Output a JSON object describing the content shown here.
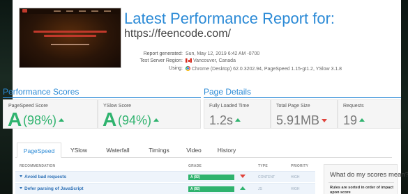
{
  "header": {
    "title": "Latest Performance Report for:",
    "url": "https://feencode.com/",
    "report_generated_label": "Report generated:",
    "report_generated_value": "Sun, May 12, 2019 6:42 AM -0700",
    "server_region_label": "Test Server Region:",
    "server_region_value": "Vancouver, Canada",
    "using_label": "Using:",
    "using_value": "Chrome (Desktop) 62.0.3202.94, PageSpeed 1.15-gt1.2, YSlow 3.1.8"
  },
  "performance_scores": {
    "title": "Performance Scores",
    "pagespeed": {
      "label": "PageSpeed Score",
      "grade": "A",
      "percent": "(98%)"
    },
    "yslow": {
      "label": "YSlow Score",
      "grade": "A",
      "percent": "(94%)"
    }
  },
  "page_details": {
    "title": "Page Details",
    "load_time": {
      "label": "Fully Loaded Time",
      "value": "1.2s",
      "trend": "up"
    },
    "page_size": {
      "label": "Total Page Size",
      "value": "5.91MB",
      "trend": "down"
    },
    "requests": {
      "label": "Requests",
      "value": "19",
      "trend": "up"
    }
  },
  "tabs": [
    "PageSpeed",
    "YSlow",
    "Waterfall",
    "Timings",
    "Video",
    "History"
  ],
  "active_tab": "PageSpeed",
  "table": {
    "headers": {
      "recommendation": "RECOMMENDATION",
      "grade": "GRADE",
      "type": "TYPE",
      "priority": "PRIORITY"
    },
    "rows": [
      {
        "name": "Avoid bad requests",
        "grade": "A (92)",
        "grade_pct": 92,
        "trend": "down",
        "type": "CONTENT",
        "priority": "HIGH"
      },
      {
        "name": "Defer parsing of JavaScript",
        "grade": "A (92)",
        "grade_pct": 92,
        "trend": "up",
        "type": "JS",
        "priority": "HIGH"
      }
    ]
  },
  "side_box": {
    "heading": "What do my scores mean?",
    "text": "Rules are sorted in order of impact upon score"
  },
  "colors": {
    "accent": "#2b8ad6",
    "good": "#2fb36e",
    "bad": "#e0433b"
  }
}
